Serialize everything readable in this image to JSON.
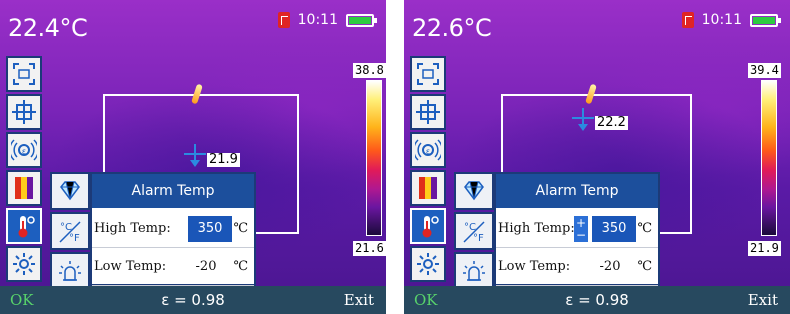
{
  "screens": [
    {
      "temp_reading": "22.4°C",
      "time": "10:11",
      "spot_temp": "21.9",
      "palette_max": "38.8",
      "palette_min": "21.6",
      "dialog": {
        "title": "Alarm Temp",
        "high_label": "High Temp:",
        "high_value": "350",
        "high_unit": "℃",
        "low_label": "Low Temp:",
        "low_value": "-20",
        "low_unit": "℃"
      },
      "bottom": {
        "ok": "OK",
        "emissivity": "ε = 0.98",
        "exit": "Exit"
      }
    },
    {
      "temp_reading": "22.6°C",
      "time": "10:11",
      "spot_temp": "22.2",
      "palette_max": "39.4",
      "palette_min": "21.9",
      "dialog": {
        "title": "Alarm Temp",
        "high_label": "High Temp:",
        "high_value": "350",
        "high_unit": "℃",
        "low_label": "Low Temp:",
        "low_value": "-20",
        "low_unit": "℃",
        "stepper_plus": "+",
        "stepper_minus": "−"
      },
      "bottom": {
        "ok": "OK",
        "emissivity": "ε = 0.98",
        "exit": "Exit"
      }
    }
  ],
  "icons": {
    "toolbar": [
      "area-measure-icon",
      "center-spot-icon",
      "emissivity-icon",
      "palette-icon",
      "alarm-temp-icon",
      "settings-icon"
    ],
    "subpanel": [
      "diamond-icon",
      "unit-c-f-icon",
      "alarm-light-icon"
    ]
  },
  "colors": {
    "dialog_header": "#1c4f9c",
    "selected_value": "#1a56b8",
    "bottom_bar": "#27495f",
    "ok_text": "#58d36b",
    "crosshair": "#2b8be0",
    "battery": "#2ecc40",
    "sd_card": "#e02424"
  }
}
